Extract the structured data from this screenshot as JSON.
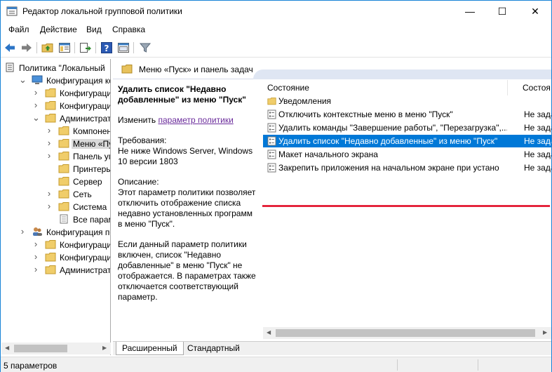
{
  "window": {
    "title": "Редактор локальной групповой политики",
    "controls": {
      "minimize": "—",
      "maximize": "☐",
      "close": "✕"
    }
  },
  "menu": [
    "Файл",
    "Действие",
    "Вид",
    "Справка"
  ],
  "toolbar": [
    "back-icon",
    "forward-icon",
    "up-folder-icon",
    "show-tree-icon",
    "export-icon",
    "help-icon",
    "properties-icon",
    "filter-icon"
  ],
  "tree": [
    {
      "label": "Политика \"Локальный",
      "level": 0,
      "expander": "",
      "icon": "document"
    },
    {
      "label": "Конфигурация комп",
      "level": 1,
      "expander": "v",
      "icon": "computer"
    },
    {
      "label": "Конфигурация п",
      "level": 2,
      "expander": ">",
      "icon": "folder"
    },
    {
      "label": "Конфигурация W",
      "level": 2,
      "expander": ">",
      "icon": "folder"
    },
    {
      "label": "Административн",
      "level": 2,
      "expander": "v",
      "icon": "folder"
    },
    {
      "label": "Компоненты",
      "level": 3,
      "expander": ">",
      "icon": "folder"
    },
    {
      "label": "Меню «Пуск»",
      "level": 3,
      "expander": ">",
      "icon": "folder",
      "selected": true
    },
    {
      "label": "Панель упра",
      "level": 3,
      "expander": ">",
      "icon": "folder"
    },
    {
      "label": "Принтеры",
      "level": 3,
      "expander": "",
      "icon": "folder"
    },
    {
      "label": "Сервер",
      "level": 3,
      "expander": "",
      "icon": "folder"
    },
    {
      "label": "Сеть",
      "level": 3,
      "expander": ">",
      "icon": "folder"
    },
    {
      "label": "Система",
      "level": 3,
      "expander": ">",
      "icon": "folder"
    },
    {
      "label": "Все параметр",
      "level": 3,
      "expander": "",
      "icon": "settings-list"
    },
    {
      "label": "Конфигурация поль",
      "level": 1,
      "expander": ">",
      "icon": "users"
    },
    {
      "label": "Конфигурация п",
      "level": 2,
      "expander": ">",
      "icon": "folder"
    },
    {
      "label": "Конфигурация W",
      "level": 2,
      "expander": ">",
      "icon": "folder"
    },
    {
      "label": "Административн",
      "level": 2,
      "expander": ">",
      "icon": "folder"
    }
  ],
  "pane_header": "Меню «Пуск» и панель задач",
  "description": {
    "title": "Удалить список \"Недавно добавленные\" из меню \"Пуск\"",
    "edit_prefix": "Изменить ",
    "edit_link": "параметр политики",
    "requirements_label": "Требования:",
    "requirements": "Не ниже Windows Server, Windows 10 версии 1803",
    "description_label": "Описание:",
    "description_p1": "Этот параметр политики позволяет отключить отображение списка недавно установленных программ в меню \"Пуск\".",
    "description_p2": "Если данный параметр политики включен, список \"Недавно добавленные\" в меню \"Пуск\" не отображается.  В параметрах также отключается соответствующий параметр."
  },
  "list": {
    "columns": [
      "Состояние",
      "Состоя"
    ],
    "rows": [
      {
        "name": "Уведомления",
        "state": "",
        "icon": "folder"
      },
      {
        "name": "Отключить контекстные меню в меню \"Пуск\"",
        "state": "Не зада",
        "icon": "setting"
      },
      {
        "name": "Удалить команды \"Завершение работы\", \"Перезагрузка\",...",
        "state": "Не зада",
        "icon": "setting"
      },
      {
        "name": "Удалить список \"Недавно добавленные\" из меню \"Пуск\"",
        "state": "Не зада",
        "icon": "setting",
        "selected": true
      },
      {
        "name": "Макет начального экрана",
        "state": "Не зада",
        "icon": "setting"
      },
      {
        "name": "Закрепить приложения на начальном экране при устано",
        "state": "Не зада",
        "icon": "setting"
      }
    ]
  },
  "tabs": [
    "Расширенный",
    "Стандартный"
  ],
  "status": "5 параметров",
  "colors": {
    "selection": "#0078d7",
    "annotation": "#e0001b",
    "link": "#6a2b9b"
  }
}
